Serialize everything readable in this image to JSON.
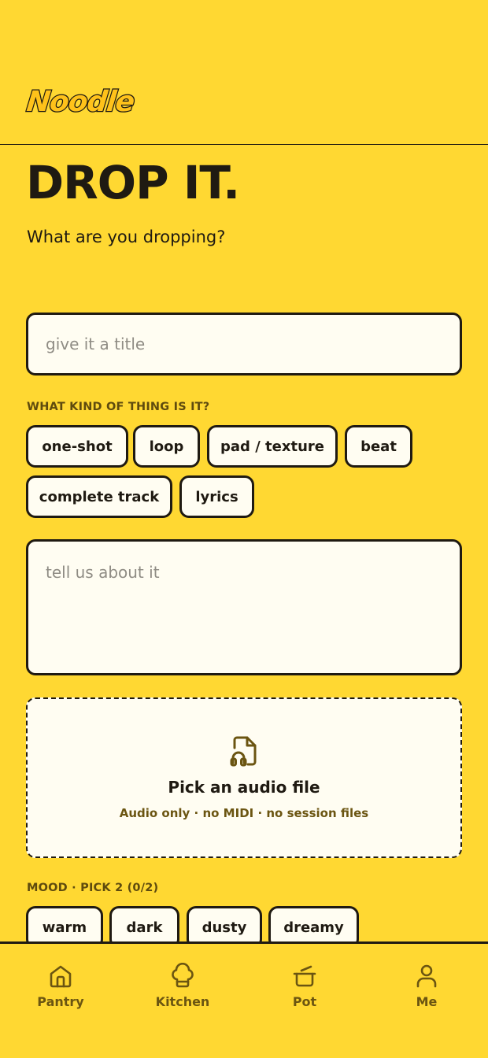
{
  "app": {
    "logo_text": "Noodle"
  },
  "page": {
    "title": "DROP IT.",
    "subtitle": "What are you dropping?"
  },
  "form": {
    "title_placeholder": "give it a title",
    "kind_label": "WHAT KIND OF THING IS IT?",
    "kinds": [
      "one-shot",
      "loop",
      "pad / texture",
      "beat",
      "complete track",
      "lyrics"
    ],
    "description_placeholder": "tell us about it",
    "dropzone": {
      "icon": "audio-file-icon",
      "title": "Pick an audio file",
      "subtitle": "Audio only · no MIDI · no session files"
    },
    "mood_label": "MOOD · PICK 2 (0/2)",
    "moods": [
      "warm",
      "dark",
      "dusty",
      "dreamy"
    ]
  },
  "nav": {
    "items": [
      {
        "label": "Pantry",
        "icon": "home-icon"
      },
      {
        "label": "Kitchen",
        "icon": "chef-hat-icon"
      },
      {
        "label": "Pot",
        "icon": "pot-icon"
      },
      {
        "label": "Me",
        "icon": "user-icon"
      }
    ]
  },
  "colors": {
    "background": "#FFD832",
    "surface": "#FFFDF2",
    "ink": "#1f1a12",
    "muted_label": "#6b5511"
  }
}
